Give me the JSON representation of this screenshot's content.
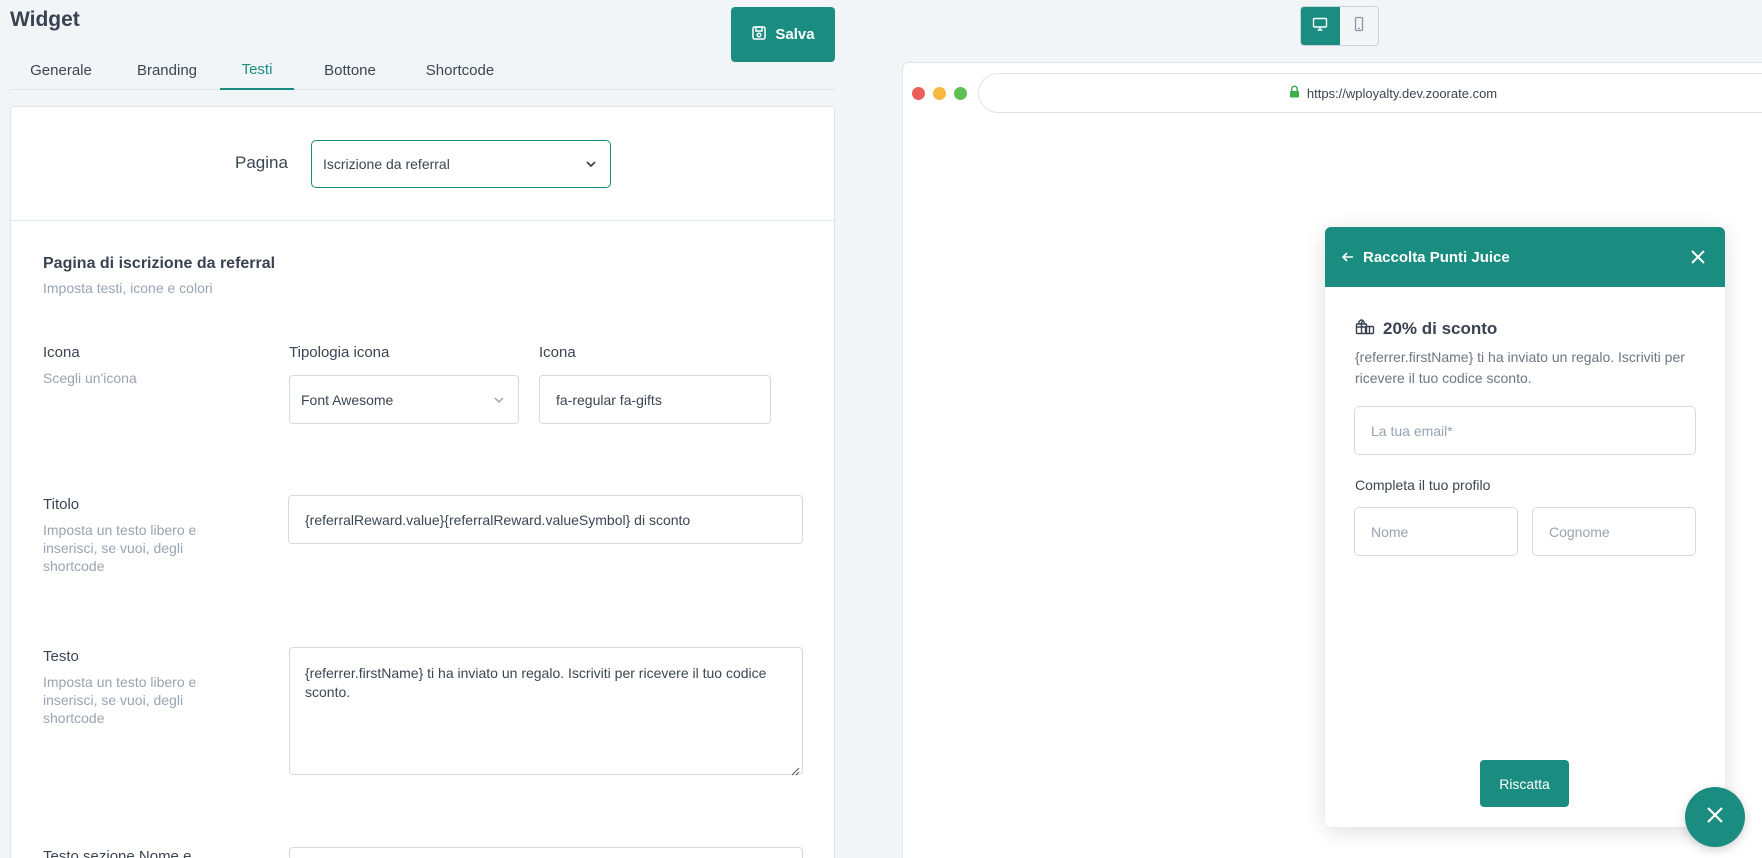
{
  "header": {
    "title": "Widget",
    "save_label": "Salva"
  },
  "tabs": [
    {
      "label": "Generale"
    },
    {
      "label": "Branding"
    },
    {
      "label": "Testi"
    },
    {
      "label": "Bottone"
    },
    {
      "label": "Shortcode"
    }
  ],
  "active_tab": "Testi",
  "page_selector": {
    "label": "Pagina",
    "value": "Iscrizione da referral"
  },
  "section": {
    "title": "Pagina di iscrizione da referral",
    "subtitle": "Imposta testi, icone e colori"
  },
  "fields": {
    "icon": {
      "label": "Icona",
      "hint": "Scegli un'icona",
      "type_label": "Tipologia icona",
      "type_value": "Font Awesome",
      "icon_label": "Icona",
      "icon_value": "fa-regular fa-gifts"
    },
    "title": {
      "label": "Titolo",
      "hint": "Imposta un testo libero e inserisci, se vuoi, degli shortcode",
      "value": "{referralReward.value}{referralReward.valueSymbol} di sconto"
    },
    "text": {
      "label": "Testo",
      "hint": "Imposta un testo libero e inserisci, se vuoi, degli shortcode",
      "value": "{referrer.firstName} ti ha inviato un regalo. Iscriviti per ricevere il tuo codice sconto."
    },
    "next_label": "Testo sezione Nome e"
  },
  "preview": {
    "url": "https://wployalty.dev.zoorate.com",
    "widget": {
      "header_title": "Raccolta Punti Juice",
      "heading": "20% di sconto",
      "text": "{referrer.firstName} ti ha inviato un regalo. Iscriviti per ricevere il tuo codice sconto.",
      "email_placeholder": "La tua email*",
      "profile_label": "Completa il tuo profilo",
      "first_name_placeholder": "Nome",
      "last_name_placeholder": "Cognome",
      "button_label": "Riscatta"
    }
  },
  "colors": {
    "accent": "#1b8c80",
    "muted": "#98a4b2",
    "text": "#3b4653"
  },
  "icons": [
    "save-icon",
    "chevron-down-icon",
    "desktop-icon",
    "mobile-icon",
    "lock-icon",
    "arrow-left-icon",
    "close-icon",
    "gifts-icon"
  ]
}
